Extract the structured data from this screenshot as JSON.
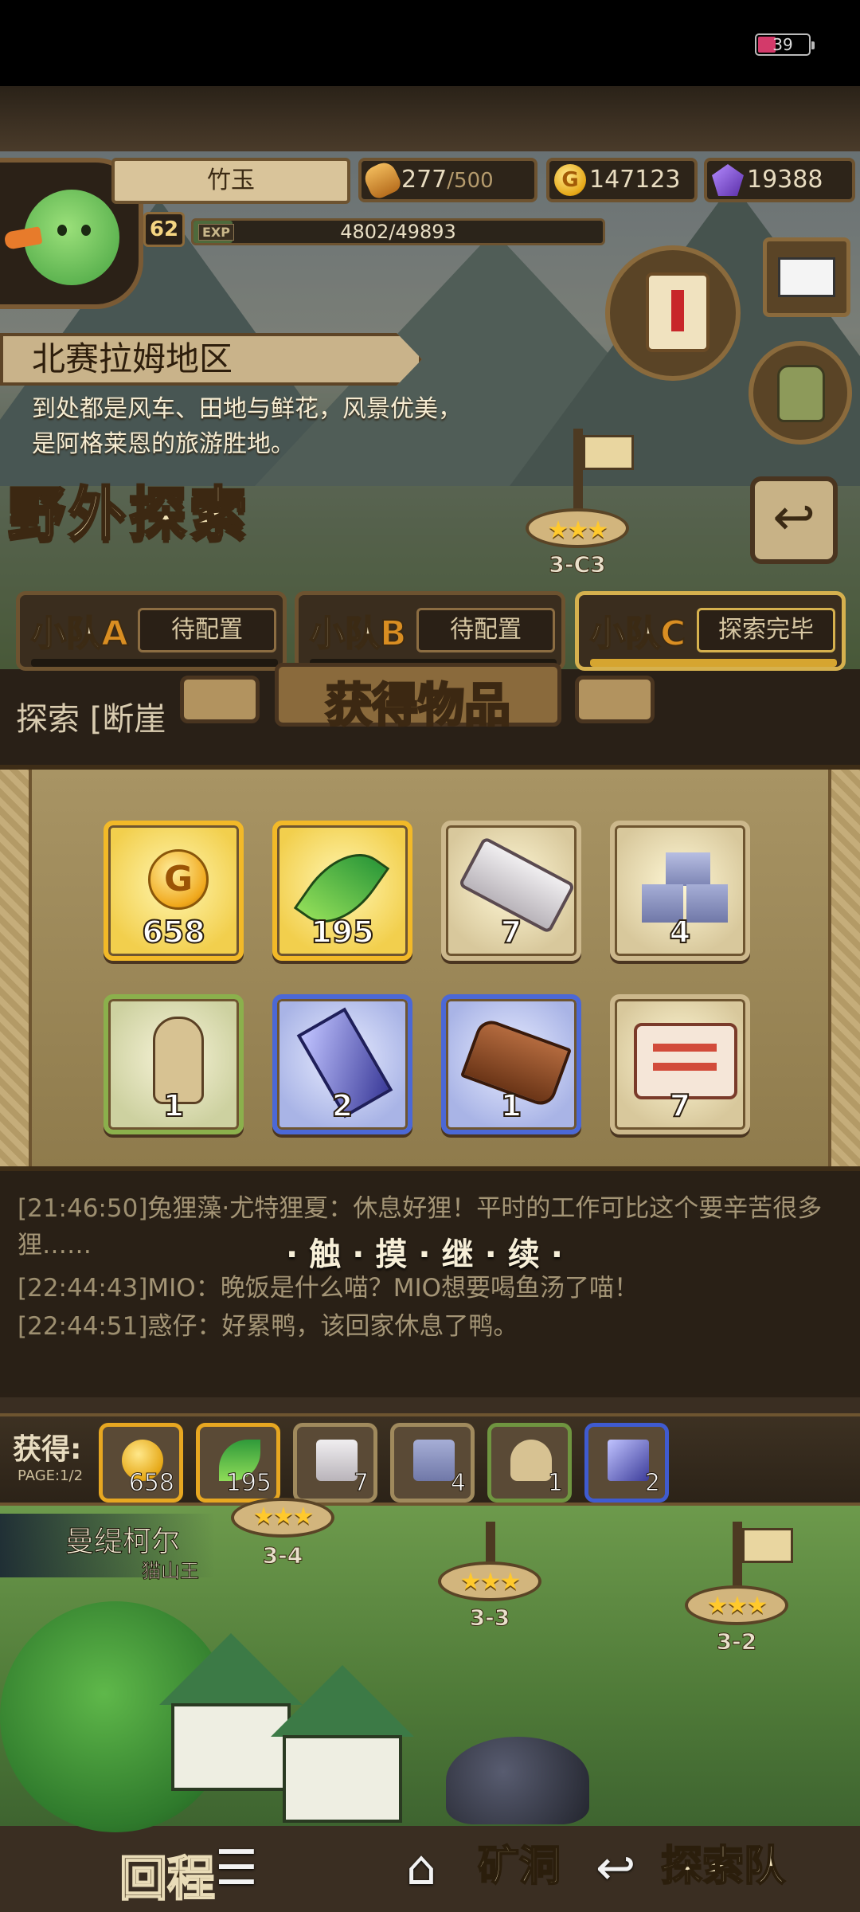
{
  "status_bar": {
    "battery": "39"
  },
  "player": {
    "name": "竹玉",
    "level": "62",
    "exp_tag": "EXP",
    "exp_text": "4802/49893",
    "exp_fraction": 0.096
  },
  "resources": {
    "stamina": "277",
    "stamina_max": "/500",
    "gold": "147123",
    "gems": "19388"
  },
  "region": {
    "name": "北赛拉姆地区",
    "description": "到处都是风车、田地与鲜花，风景优美，是阿格莱恩的旅游胜地。"
  },
  "mode_title": "野外探索",
  "stages": {
    "top": {
      "label": "3-C3",
      "stars": "★★★"
    },
    "s34": {
      "label": "3-4",
      "stars": "★★★"
    },
    "s33": {
      "label": "3-3",
      "stars": "★★★"
    },
    "s32": {
      "label": "3-2",
      "stars": "★★★"
    }
  },
  "back_button": "↩",
  "squads": [
    {
      "prefix": "小队",
      "letter": "A",
      "status": "待配置"
    },
    {
      "prefix": "小队",
      "letter": "B",
      "status": "待配置"
    },
    {
      "prefix": "小队",
      "letter": "C",
      "status": "探索完毕"
    }
  ],
  "explore_line": "探索 [断崖",
  "popup": {
    "title": "获得物品",
    "items": [
      {
        "name": "gold-coin",
        "rarity": "gold",
        "count": "658"
      },
      {
        "name": "green-feather",
        "rarity": "gold",
        "count": "195"
      },
      {
        "name": "stone-slab",
        "rarity": "common",
        "count": "7"
      },
      {
        "name": "stone-blocks",
        "rarity": "common",
        "count": "4"
      },
      {
        "name": "rabbit-doll",
        "rarity": "green",
        "count": "1"
      },
      {
        "name": "crystal-bar",
        "rarity": "blue",
        "count": "2"
      },
      {
        "name": "wood-planks",
        "rarity": "blue",
        "count": "1"
      },
      {
        "name": "treasure-scroll",
        "rarity": "common",
        "count": "7"
      }
    ]
  },
  "chat": [
    {
      "time": "[21:46:50]",
      "text": "兔狸藻·尤特狸夏：休息好狸！平时的工作可比这个要辛苦很多狸……"
    },
    {
      "time": "[22:44:43]",
      "text": "MIO：晚饭是什么喵？MIO想要喝鱼汤了喵！"
    },
    {
      "time": "[22:44:51]",
      "text": "惑仔：好累鸭，该回家休息了鸭。"
    }
  ],
  "tap_continue": "·触·摸·继·续·",
  "obtained": {
    "label": "获得:",
    "page": "PAGE:1/2",
    "items": [
      {
        "rarity": "gold",
        "count": "658"
      },
      {
        "rarity": "gold",
        "count": "195"
      },
      {
        "rarity": "common",
        "count": "7"
      },
      {
        "rarity": "common",
        "count": "4"
      },
      {
        "rarity": "green",
        "count": "1"
      },
      {
        "rarity": "blue",
        "count": "2"
      }
    ]
  },
  "boss": {
    "name": "曼缇柯尔",
    "title": "猫山王"
  },
  "bottom_buttons": {
    "return": "回程",
    "mine": "矿洞",
    "team": "探索队"
  },
  "colors": {
    "gold_rarity": "#f2b928",
    "blue_rarity": "#4b68d6",
    "green_rarity": "#8bb04c"
  }
}
